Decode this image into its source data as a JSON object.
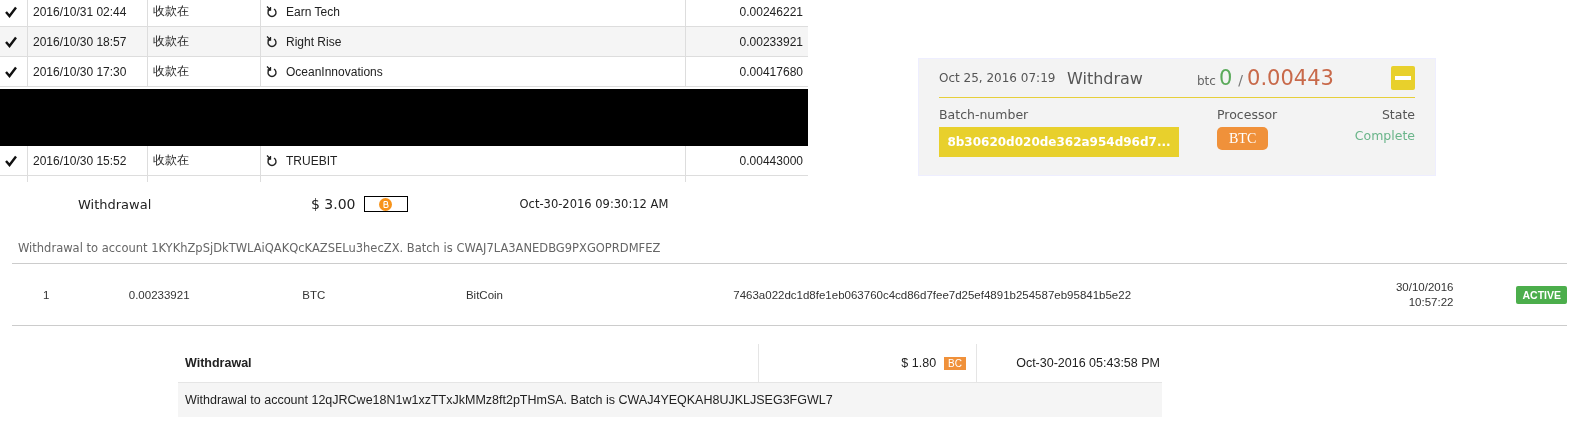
{
  "transactions": [
    {
      "kind": "tx",
      "confirmed": true,
      "datetime": "2016/10/31 02:44",
      "type": "收款在",
      "name": "Earn Tech",
      "amount": "0.00246221"
    },
    {
      "kind": "tx",
      "confirmed": true,
      "datetime": "2016/10/30 18:57",
      "type": "收款在",
      "name": "Right Rise",
      "amount": "0.00233921"
    },
    {
      "kind": "tx",
      "confirmed": true,
      "datetime": "2016/10/30 17:30",
      "type": "收款在",
      "name": "OceanInnovations",
      "amount": "0.00417680"
    },
    {
      "kind": "redacted"
    },
    {
      "kind": "tx",
      "confirmed": true,
      "datetime": "2016/10/30 15:52",
      "type": "收款在",
      "name": "TRUEBIT",
      "amount": "0.00443000"
    }
  ],
  "withdraw_card": {
    "date": "Oct 25, 2016 07:19",
    "title": "Withdraw",
    "unit": "btc",
    "received": "0",
    "separator": "/",
    "total": "0.00443",
    "batch_label": "Batch-number",
    "batch_number": "8b30620d020de362a954d96d7...",
    "processor_label": "Processor",
    "processor": "BTC",
    "state_label": "State",
    "state": "Complete"
  },
  "withdrawal_1": {
    "label": "Withdrawal",
    "amount": "$ 3.00",
    "date": "Oct-30-2016 09:30:12 AM",
    "note": "Withdrawal to account 1KYKhZpSjDkTWLAiQAKQcKAZSELu3hecZX. Batch is CWAJ7LA3ANEDBG9PXGOPRDMFEZ"
  },
  "payment_row": {
    "number": "1",
    "amount": "0.00233921",
    "currency": "BTC",
    "method": "BitCoin",
    "hash": "7463a022dc1d8fe1eb063760c4cd86d7fee7d25ef4891b254587eb95841b5e22",
    "date": "30/10/2016",
    "time": "10:57:22",
    "status": "ACTIVE"
  },
  "withdrawal_2": {
    "label": "Withdrawal",
    "amount": "$ 1.80",
    "badge": "BC",
    "date": "Oct-30-2016 05:43:58 PM",
    "note": "Withdrawal to account 12qJRCwe18N1w1xzTTxJkMMz8ft2pTHmSA. Batch is CWAJ4YEQKAH8UJKLJSEG3FGWL7"
  }
}
